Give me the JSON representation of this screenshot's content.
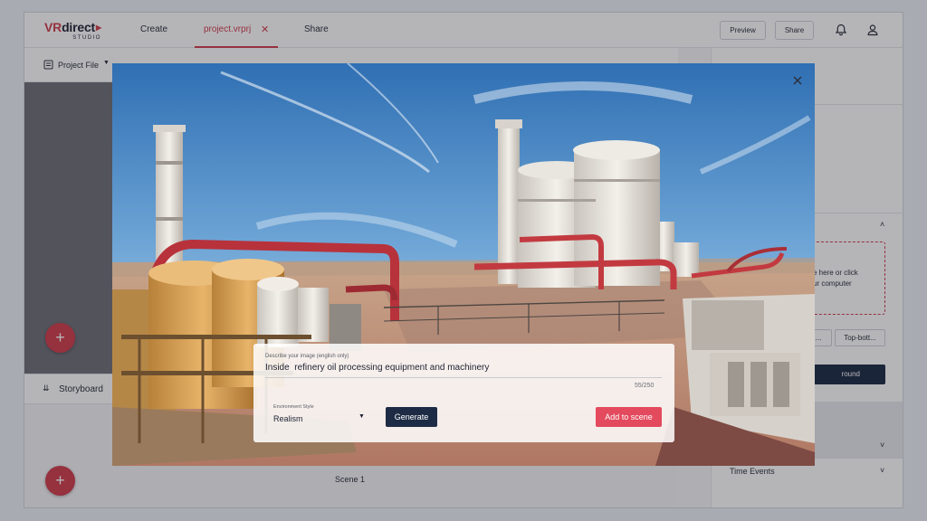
{
  "app": {
    "logo_main": "VRdirect",
    "logo_sub": "STUDIO",
    "nav_create": "Create",
    "tab_project": "project.vrprj",
    "nav_share": "Share",
    "preview_button": "Preview",
    "share_button": "Share",
    "project_file": "Project File",
    "storyboard": "Storyboard",
    "scene_name": "Scene 1",
    "right_panel": {
      "drop_text_line1": "e here or click",
      "drop_text_line2": "ur computer",
      "option_left": "...",
      "option_right": "Top-bott...",
      "dark_button": "round",
      "time_events": "Time Events"
    }
  },
  "modal": {
    "description_label": "Describe your image (english only)",
    "description_value": "Inside  refinery oil processing equipment and machinery",
    "char_count": "55/250",
    "environment_style_label": "Environment Style",
    "environment_style_value": "Realism",
    "generate_button": "Generate",
    "add_button": "Add to scene"
  },
  "colors": {
    "brand_red": "#d13d4c",
    "navy": "#1d2b45",
    "add_button": "#e34a5d"
  }
}
